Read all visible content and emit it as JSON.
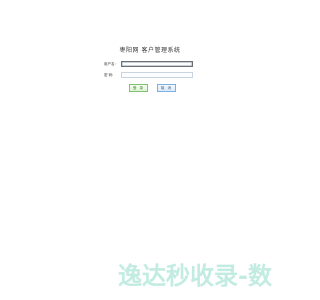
{
  "app": {
    "title": "枣阳网  客户管理系统"
  },
  "login_form": {
    "username": {
      "label": "用户名:",
      "value": "",
      "placeholder": ""
    },
    "password": {
      "label": "密  码:",
      "value": "",
      "placeholder": ""
    },
    "login_button_label": "登  录",
    "reset_button_label": "取  消"
  },
  "watermark": {
    "text": "逸达秒收录-数"
  },
  "colors": {
    "login_button_border": "#7fc26d",
    "reset_button_border": "#7fb0dc",
    "watermark": "#c2ece1"
  }
}
